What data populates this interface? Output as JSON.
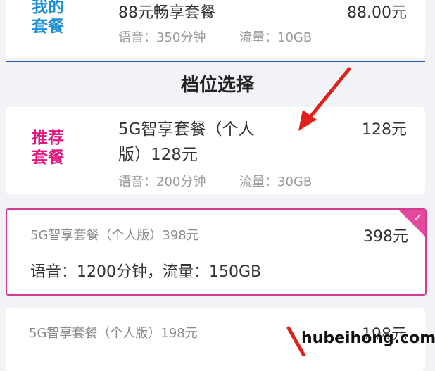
{
  "current_plan": {
    "tag_line1": "我的",
    "tag_line2": "套餐",
    "name": "88元畅享套餐",
    "price": "88.00元",
    "voice": "语音：350分钟",
    "data": "流量：10GB"
  },
  "section_title": "档位选择",
  "recommended_plan": {
    "tag_line1": "推荐",
    "tag_line2": "套餐",
    "name_line1": "5G智享套餐（个人",
    "name_line2": "版）128元",
    "price": "128元",
    "voice": "语音：200分钟",
    "data": "流量：30GB"
  },
  "selected_plan": {
    "name": "5G智享套餐（个人版）398元",
    "price": "398元",
    "detail": "语音：1200分钟，流量：150GB",
    "check": "✓"
  },
  "plan_198": {
    "name": "5G智享套餐（个人版）198元",
    "price": "198元"
  },
  "watermark": "hubeihong.com",
  "colors": {
    "my_plan_tag": "#1a8fd6",
    "recommend_tag": "#e0177f",
    "selected_border": "#d43c8f",
    "arrow": "#e0201b",
    "divider": "#2f5aa6"
  }
}
